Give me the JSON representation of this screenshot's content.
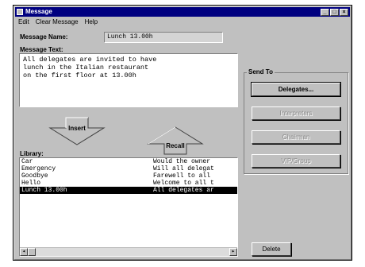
{
  "window": {
    "title": "Message",
    "controls": {
      "minimize": "_",
      "maximize": "□",
      "close": "×"
    }
  },
  "menu": [
    "Edit",
    "Clear Message",
    "Help"
  ],
  "message_name": {
    "label": "Message Name:",
    "value": "Lunch 13.00h"
  },
  "message_text": {
    "label": "Message Text:",
    "value": "All delegates are invited to have\nlunch in the Italian restaurant\non the first floor at 13.00h"
  },
  "send_to": {
    "title": "Send To",
    "buttons": [
      {
        "label": "Delegates...",
        "enabled": true
      },
      {
        "label": "Interpreters",
        "enabled": false
      },
      {
        "label": "Chairman",
        "enabled": false
      },
      {
        "label": "VIP/Group",
        "enabled": false
      }
    ]
  },
  "actions": {
    "insert": "Insert",
    "recall": "Recall",
    "delete": "Delete"
  },
  "library": {
    "label": "Library:",
    "rows": [
      {
        "name": "Car",
        "text": "Would the owner",
        "selected": false
      },
      {
        "name": "Emergency",
        "text": "Will all delegat",
        "selected": false
      },
      {
        "name": "Goodbye",
        "text": "Farewell to all",
        "selected": false
      },
      {
        "name": "Hello",
        "text": "Welcome to all t",
        "selected": false
      },
      {
        "name": "Lunch 13.00h",
        "text": "All delegates ar",
        "selected": true
      }
    ],
    "scroll_left": "◂",
    "scroll_right": "▸"
  }
}
